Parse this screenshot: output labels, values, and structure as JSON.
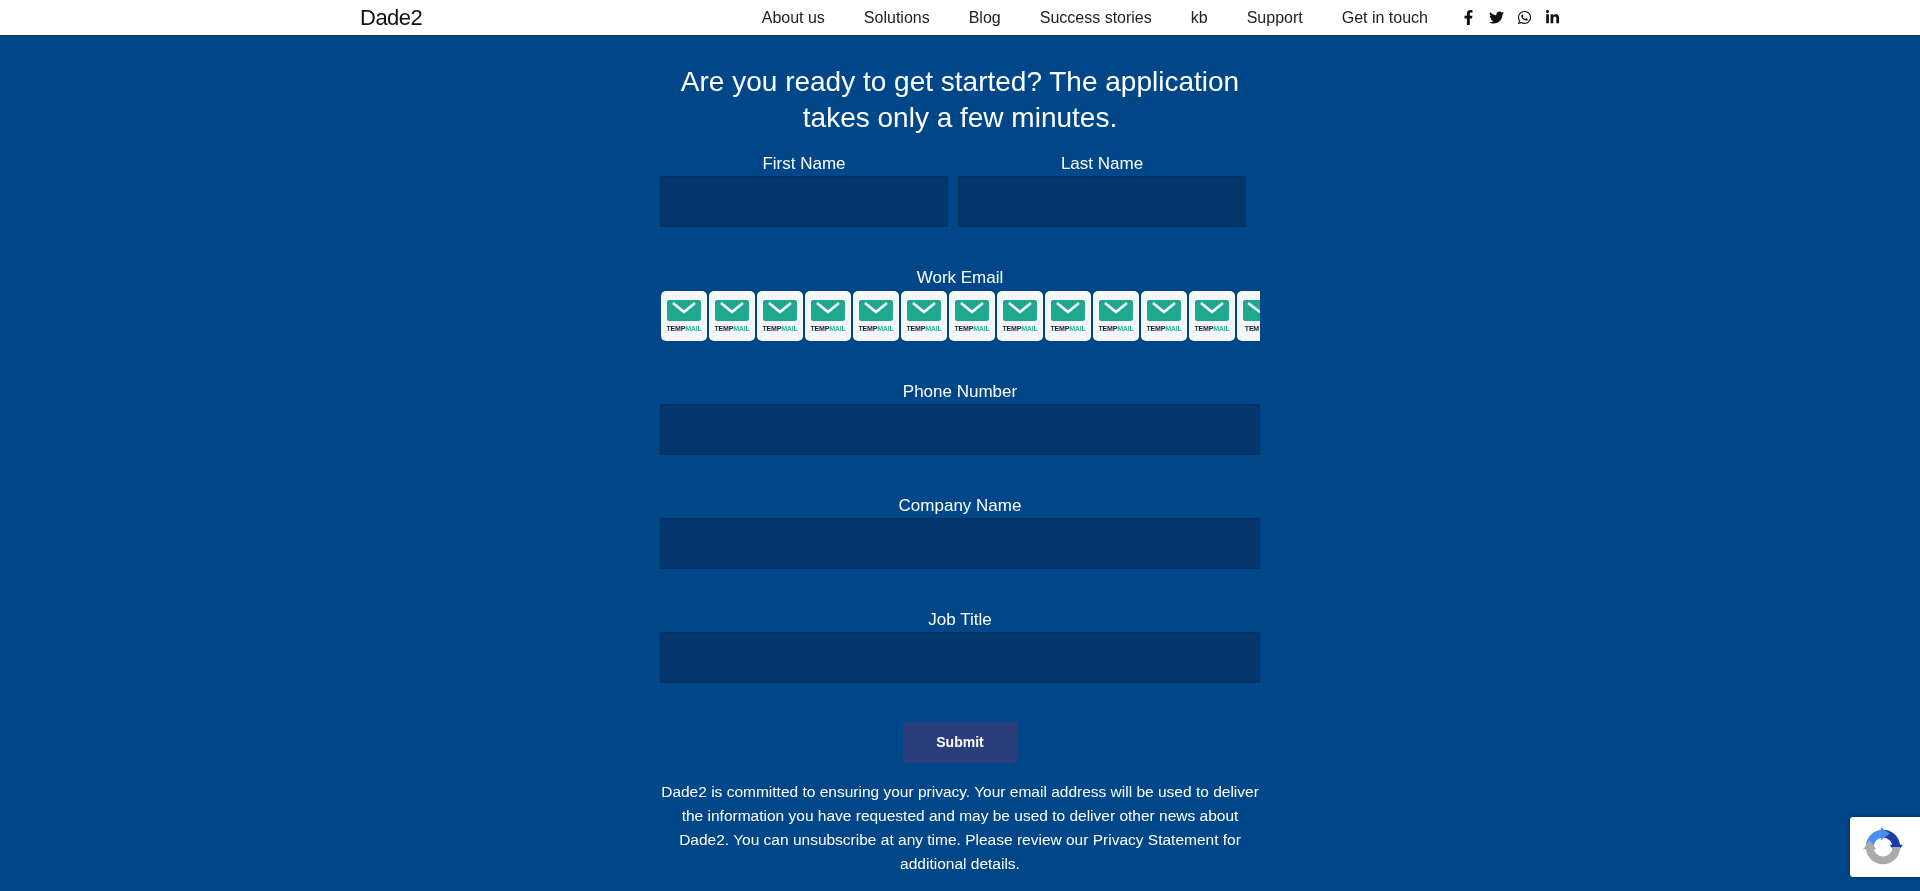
{
  "header": {
    "logo": "Dade2",
    "nav": [
      {
        "label": "About us"
      },
      {
        "label": "Solutions"
      },
      {
        "label": "Blog"
      },
      {
        "label": "Success stories"
      },
      {
        "label": "kb"
      },
      {
        "label": "Support"
      },
      {
        "label": "Get in touch"
      }
    ]
  },
  "form": {
    "title": "Are you ready to get started? The application takes only a few minutes.",
    "rows": [
      {
        "fields": [
          {
            "label": "First Name",
            "kind": "input"
          },
          {
            "label": "Last Name",
            "kind": "input"
          }
        ]
      },
      {
        "fields": [
          {
            "label": "Work Email",
            "kind": "tiles",
            "tiles": [
              {
                "kind": "full",
                "dark": "TEMP",
                "accent": "MAIL"
              },
              {
                "kind": "full",
                "dark": "TEMP",
                "accent": "MAIL"
              },
              {
                "kind": "full",
                "dark": "TEMP",
                "accent": "MAIL"
              },
              {
                "kind": "full",
                "dark": "TEMP",
                "accent": "MAIL"
              },
              {
                "kind": "full",
                "dark": "TEMP",
                "accent": "MAIL"
              },
              {
                "kind": "full",
                "dark": "TEMP",
                "accent": "MAIL"
              },
              {
                "kind": "full",
                "dark": "TEMP",
                "accent": "MAIL"
              },
              {
                "kind": "full",
                "dark": "TEMP",
                "accent": "MAIL"
              },
              {
                "kind": "full",
                "dark": "TEMP",
                "accent": "MAIL"
              },
              {
                "kind": "full",
                "dark": "TEMP",
                "accent": "MAIL"
              },
              {
                "kind": "full",
                "dark": "TEMP",
                "accent": "MAIL"
              },
              {
                "kind": "full",
                "dark": "TEMP",
                "accent": "MAIL"
              },
              {
                "kind": "cut",
                "dark": "TEM"
              }
            ]
          }
        ]
      },
      {
        "fields": [
          {
            "label": "Phone Number",
            "kind": "input"
          }
        ]
      },
      {
        "fields": [
          {
            "label": "Company Name",
            "kind": "input"
          }
        ]
      },
      {
        "fields": [
          {
            "label": "Job Title",
            "kind": "input"
          }
        ]
      }
    ],
    "submit": "Submit",
    "privacy": "Dade2 is committed to ensuring your privacy. Your email address will be used to deliver the information you have requested and may be used to deliver other news about Dade2. You can unsubscribe at any time. Please review our Privacy Statement for additional details."
  }
}
